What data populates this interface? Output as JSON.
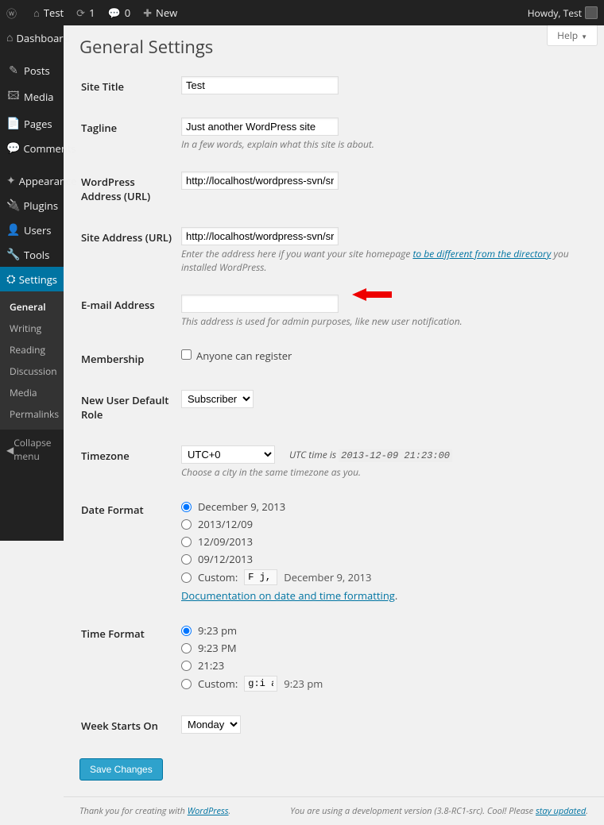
{
  "adminbar": {
    "site_name": "Test",
    "updates": "1",
    "comments": "0",
    "new_label": "New",
    "howdy": "Howdy, Test",
    "help_label": "Help"
  },
  "sidebar": {
    "items": [
      {
        "label": "Dashboard",
        "icon": "⌂"
      },
      {
        "label": "Posts",
        "icon": "✎"
      },
      {
        "label": "Media",
        "icon": "🖾"
      },
      {
        "label": "Pages",
        "icon": "📄"
      },
      {
        "label": "Comments",
        "icon": "💬"
      },
      {
        "label": "Appearance",
        "icon": "✦"
      },
      {
        "label": "Plugins",
        "icon": "🔌"
      },
      {
        "label": "Users",
        "icon": "👤"
      },
      {
        "label": "Tools",
        "icon": "🔧"
      },
      {
        "label": "Settings",
        "icon": "⛭"
      }
    ],
    "submenu": [
      "General",
      "Writing",
      "Reading",
      "Discussion",
      "Media",
      "Permalinks"
    ],
    "collapse": "Collapse menu"
  },
  "page": {
    "title": "General Settings",
    "fields": {
      "site_title": {
        "label": "Site Title",
        "value": "Test"
      },
      "tagline": {
        "label": "Tagline",
        "value": "Just another WordPress site",
        "desc": "In a few words, explain what this site is about."
      },
      "wp_url": {
        "label": "WordPress Address (URL)",
        "value": "http://localhost/wordpress-svn/src"
      },
      "site_url": {
        "label": "Site Address (URL)",
        "value": "http://localhost/wordpress-svn/src",
        "desc_pre": "Enter the address here if you want your site homepage ",
        "desc_link": "to be different from the directory",
        "desc_post": " you installed WordPress."
      },
      "email": {
        "label": "E-mail Address",
        "value": "",
        "desc": "This address is used for admin purposes, like new user notification."
      },
      "membership": {
        "label": "Membership",
        "checkbox_label": "Anyone can register"
      },
      "default_role": {
        "label": "New User Default Role",
        "value": "Subscriber"
      },
      "timezone": {
        "label": "Timezone",
        "value": "UTC+0",
        "utc_pre": "UTC time is ",
        "utc_time": "2013-12-09 21:23:00",
        "desc": "Choose a city in the same timezone as you."
      },
      "date_format": {
        "label": "Date Format",
        "options": [
          "December 9, 2013",
          "2013/12/09",
          "12/09/2013",
          "09/12/2013"
        ],
        "custom_label": "Custom:",
        "custom_value": "F j, Y",
        "custom_example": "December 9, 2013",
        "doc_link": "Documentation on date and time formatting"
      },
      "time_format": {
        "label": "Time Format",
        "options": [
          "9:23 pm",
          "9:23 PM",
          "21:23"
        ],
        "custom_label": "Custom:",
        "custom_value": "g:i a",
        "custom_example": "9:23 pm"
      },
      "week_start": {
        "label": "Week Starts On",
        "value": "Monday"
      }
    },
    "submit": "Save Changes"
  },
  "footer": {
    "thanks_pre": "Thank you for creating with ",
    "thanks_link": "WordPress",
    "thanks_post": ".",
    "version_pre": "You are using a development version (3.8-RC1-src). Cool! Please ",
    "version_link": "stay updated",
    "version_post": "."
  }
}
